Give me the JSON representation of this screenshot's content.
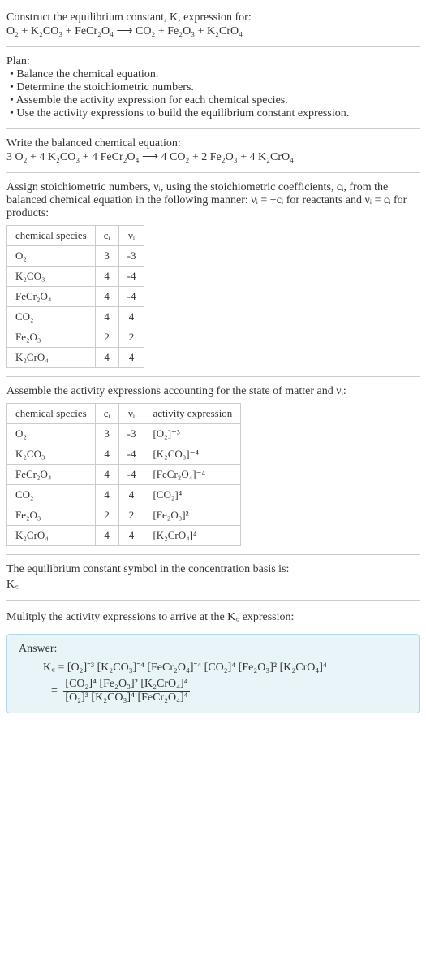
{
  "header": {
    "title_line1": "Construct the equilibrium constant, K, expression for:",
    "equation": "O₂ + K₂CO₃ + FeCr₂O₄ ⟶ CO₂ + Fe₂O₃ + K₂CrO₄"
  },
  "plan": {
    "label": "Plan:",
    "items": [
      "• Balance the chemical equation.",
      "• Determine the stoichiometric numbers.",
      "• Assemble the activity expression for each chemical species.",
      "• Use the activity expressions to build the equilibrium constant expression."
    ]
  },
  "balanced": {
    "label": "Write the balanced chemical equation:",
    "equation": "3 O₂ + 4 K₂CO₃ + 4 FeCr₂O₄ ⟶ 4 CO₂ + 2 Fe₂O₃ + 4 K₂CrO₄"
  },
  "stoich": {
    "text": "Assign stoichiometric numbers, νᵢ, using the stoichiometric coefficients, cᵢ, from the balanced chemical equation in the following manner: νᵢ = −cᵢ for reactants and νᵢ = cᵢ for products:",
    "headers": [
      "chemical species",
      "cᵢ",
      "νᵢ"
    ],
    "rows": [
      {
        "species": "O₂",
        "c": "3",
        "v": "-3"
      },
      {
        "species": "K₂CO₃",
        "c": "4",
        "v": "-4"
      },
      {
        "species": "FeCr₂O₄",
        "c": "4",
        "v": "-4"
      },
      {
        "species": "CO₂",
        "c": "4",
        "v": "4"
      },
      {
        "species": "Fe₂O₃",
        "c": "2",
        "v": "2"
      },
      {
        "species": "K₂CrO₄",
        "c": "4",
        "v": "4"
      }
    ]
  },
  "activity": {
    "text": "Assemble the activity expressions accounting for the state of matter and νᵢ:",
    "headers": [
      "chemical species",
      "cᵢ",
      "νᵢ",
      "activity expression"
    ],
    "rows": [
      {
        "species": "O₂",
        "c": "3",
        "v": "-3",
        "expr": "[O₂]⁻³"
      },
      {
        "species": "K₂CO₃",
        "c": "4",
        "v": "-4",
        "expr": "[K₂CO₃]⁻⁴"
      },
      {
        "species": "FeCr₂O₄",
        "c": "4",
        "v": "-4",
        "expr": "[FeCr₂O₄]⁻⁴"
      },
      {
        "species": "CO₂",
        "c": "4",
        "v": "4",
        "expr": "[CO₂]⁴"
      },
      {
        "species": "Fe₂O₃",
        "c": "2",
        "v": "2",
        "expr": "[Fe₂O₃]²"
      },
      {
        "species": "K₂CrO₄",
        "c": "4",
        "v": "4",
        "expr": "[K₂CrO₄]⁴"
      }
    ]
  },
  "eq_symbol": {
    "line1": "The equilibrium constant symbol in the concentration basis is:",
    "line2": "K꜀"
  },
  "multiply": {
    "text": "Mulitply the activity expressions to arrive at the K꜀ expression:"
  },
  "answer": {
    "label": "Answer:",
    "line1": "K꜀ = [O₂]⁻³ [K₂CO₃]⁻⁴ [FeCr₂O₄]⁻⁴ [CO₂]⁴ [Fe₂O₃]² [K₂CrO₄]⁴",
    "eq_prefix": "= ",
    "frac_num": "[CO₂]⁴ [Fe₂O₃]² [K₂CrO₄]⁴",
    "frac_den": "[O₂]³ [K₂CO₃]⁴ [FeCr₂O₄]⁴"
  }
}
